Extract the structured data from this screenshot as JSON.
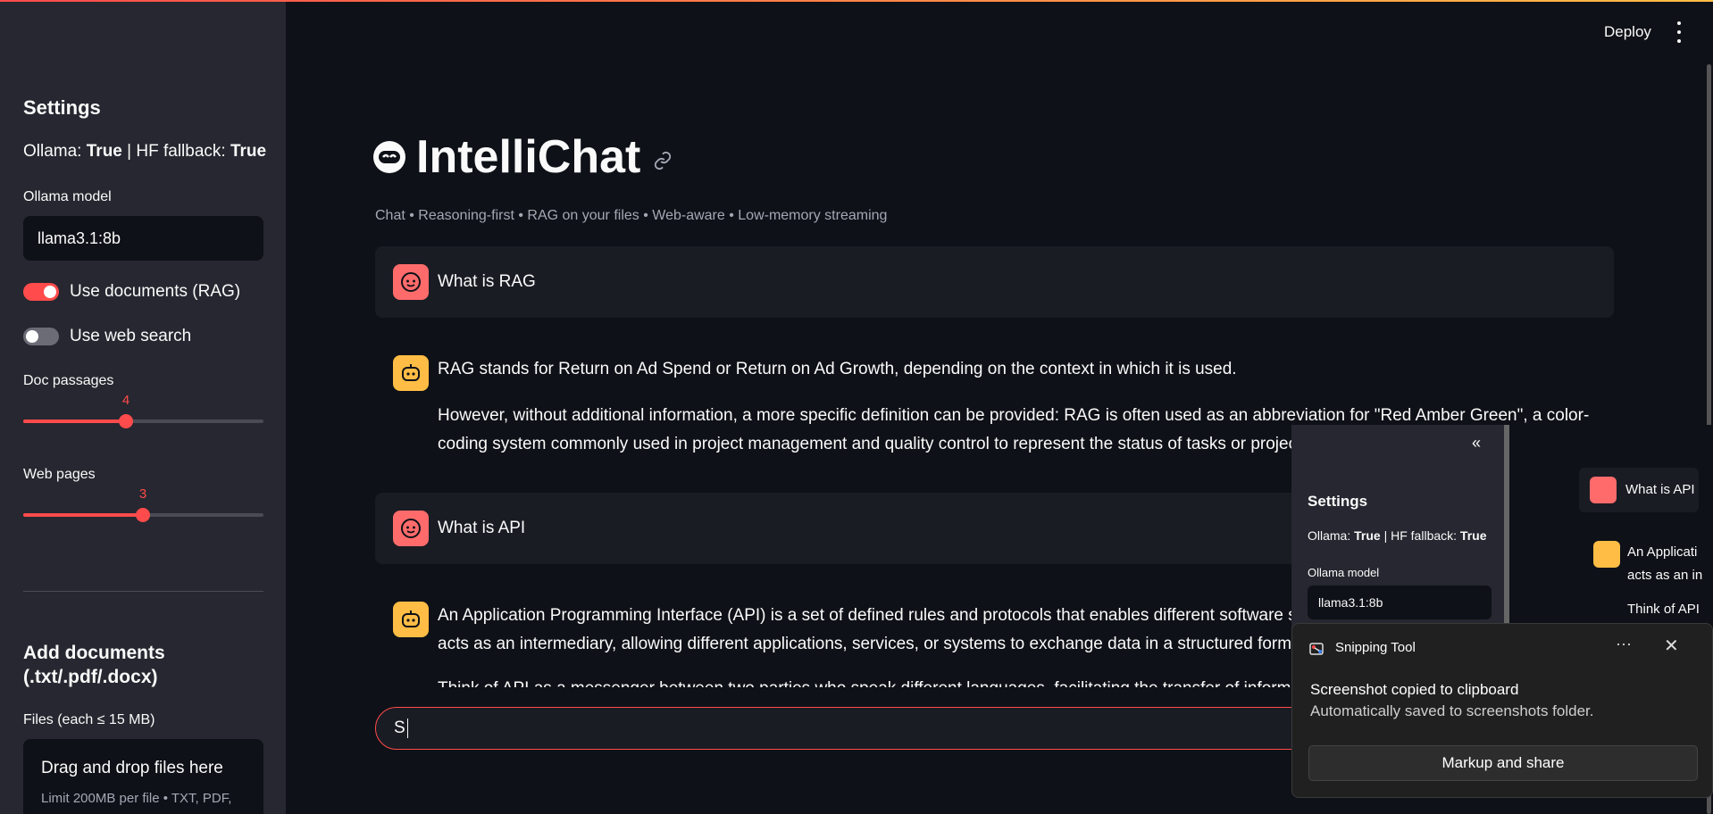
{
  "header": {
    "deploy_label": "Deploy",
    "menu_icon": "kebab-menu-icon"
  },
  "sidebar": {
    "title": "Settings",
    "status": {
      "ollama_label": "Ollama:",
      "ollama_value": "True",
      "separator": "|",
      "hf_label": "HF fallback:",
      "hf_value": "True"
    },
    "model_label": "Ollama model",
    "model_value": "llama3.1:8b",
    "use_documents": {
      "label": "Use documents (RAG)",
      "on": true
    },
    "use_web": {
      "label": "Use web search",
      "on": false
    },
    "doc_passages": {
      "label": "Doc passages",
      "value": "4",
      "fraction": 0.43
    },
    "web_pages": {
      "label": "Web pages",
      "value": "3",
      "fraction": 0.5
    },
    "add_docs_title": "Add documents (.txt/.pdf/.docx)",
    "files_label": "Files (each ≤ 15 MB)",
    "dropzone": {
      "title": "Drag and drop files here",
      "subtitle": "Limit 200MB per file • TXT, PDF,"
    }
  },
  "main": {
    "title": "IntelliChat",
    "caption": "Chat • Reasoning-first • RAG on your files • Web-aware • Low-memory streaming",
    "messages": [
      {
        "role": "user",
        "text": "What is RAG"
      },
      {
        "role": "assistant",
        "lines": [
          "RAG stands for Return on Ad Spend or Return on Ad Growth, depending on the context in which it is used.",
          "However, without additional information, a more specific definition can be provided: RAG is often used as an abbreviation for \"Red Amber Green\", a color-",
          "coding system commonly used in project management and quality control to represent the status of tasks or projec"
        ]
      },
      {
        "role": "user",
        "text": "What is API"
      },
      {
        "role": "assistant",
        "lines": [
          "An Application Programming Interface (API) is a set of defined rules and protocols that enables different software sy",
          "acts as an intermediary, allowing different applications, services, or systems to exchange data in a structured forma",
          "Think of API as a messenger between two parties who speak different languages, facilitating the transfer of informati"
        ]
      }
    ],
    "chat_input_value": "S"
  },
  "preview": {
    "collapse_icon": "double-chevron-left-icon",
    "title": "Settings",
    "status_text": {
      "a": "Ollama:",
      "b": "True",
      "c": "| HF fallback:",
      "d": "True"
    },
    "model_label": "Ollama model",
    "model_value": "llama3.1:8b",
    "user_msg": "What is API",
    "bot_line1": "An Applicati",
    "bot_line2": "acts as an in",
    "bot_line3": "Think of API"
  },
  "toast": {
    "app_name": "Snipping Tool",
    "more_icon": "more-icon",
    "close_icon": "close-icon",
    "title": "Screenshot copied to clipboard",
    "subtitle": "Automatically saved to screenshots folder.",
    "button": "Markup and share"
  },
  "colors": {
    "accent": "#ff4b4b",
    "user_avatar": "#ff6b6b",
    "bot_avatar": "#ffbd45",
    "background": "#0e1117",
    "sidebar": "#262730"
  }
}
